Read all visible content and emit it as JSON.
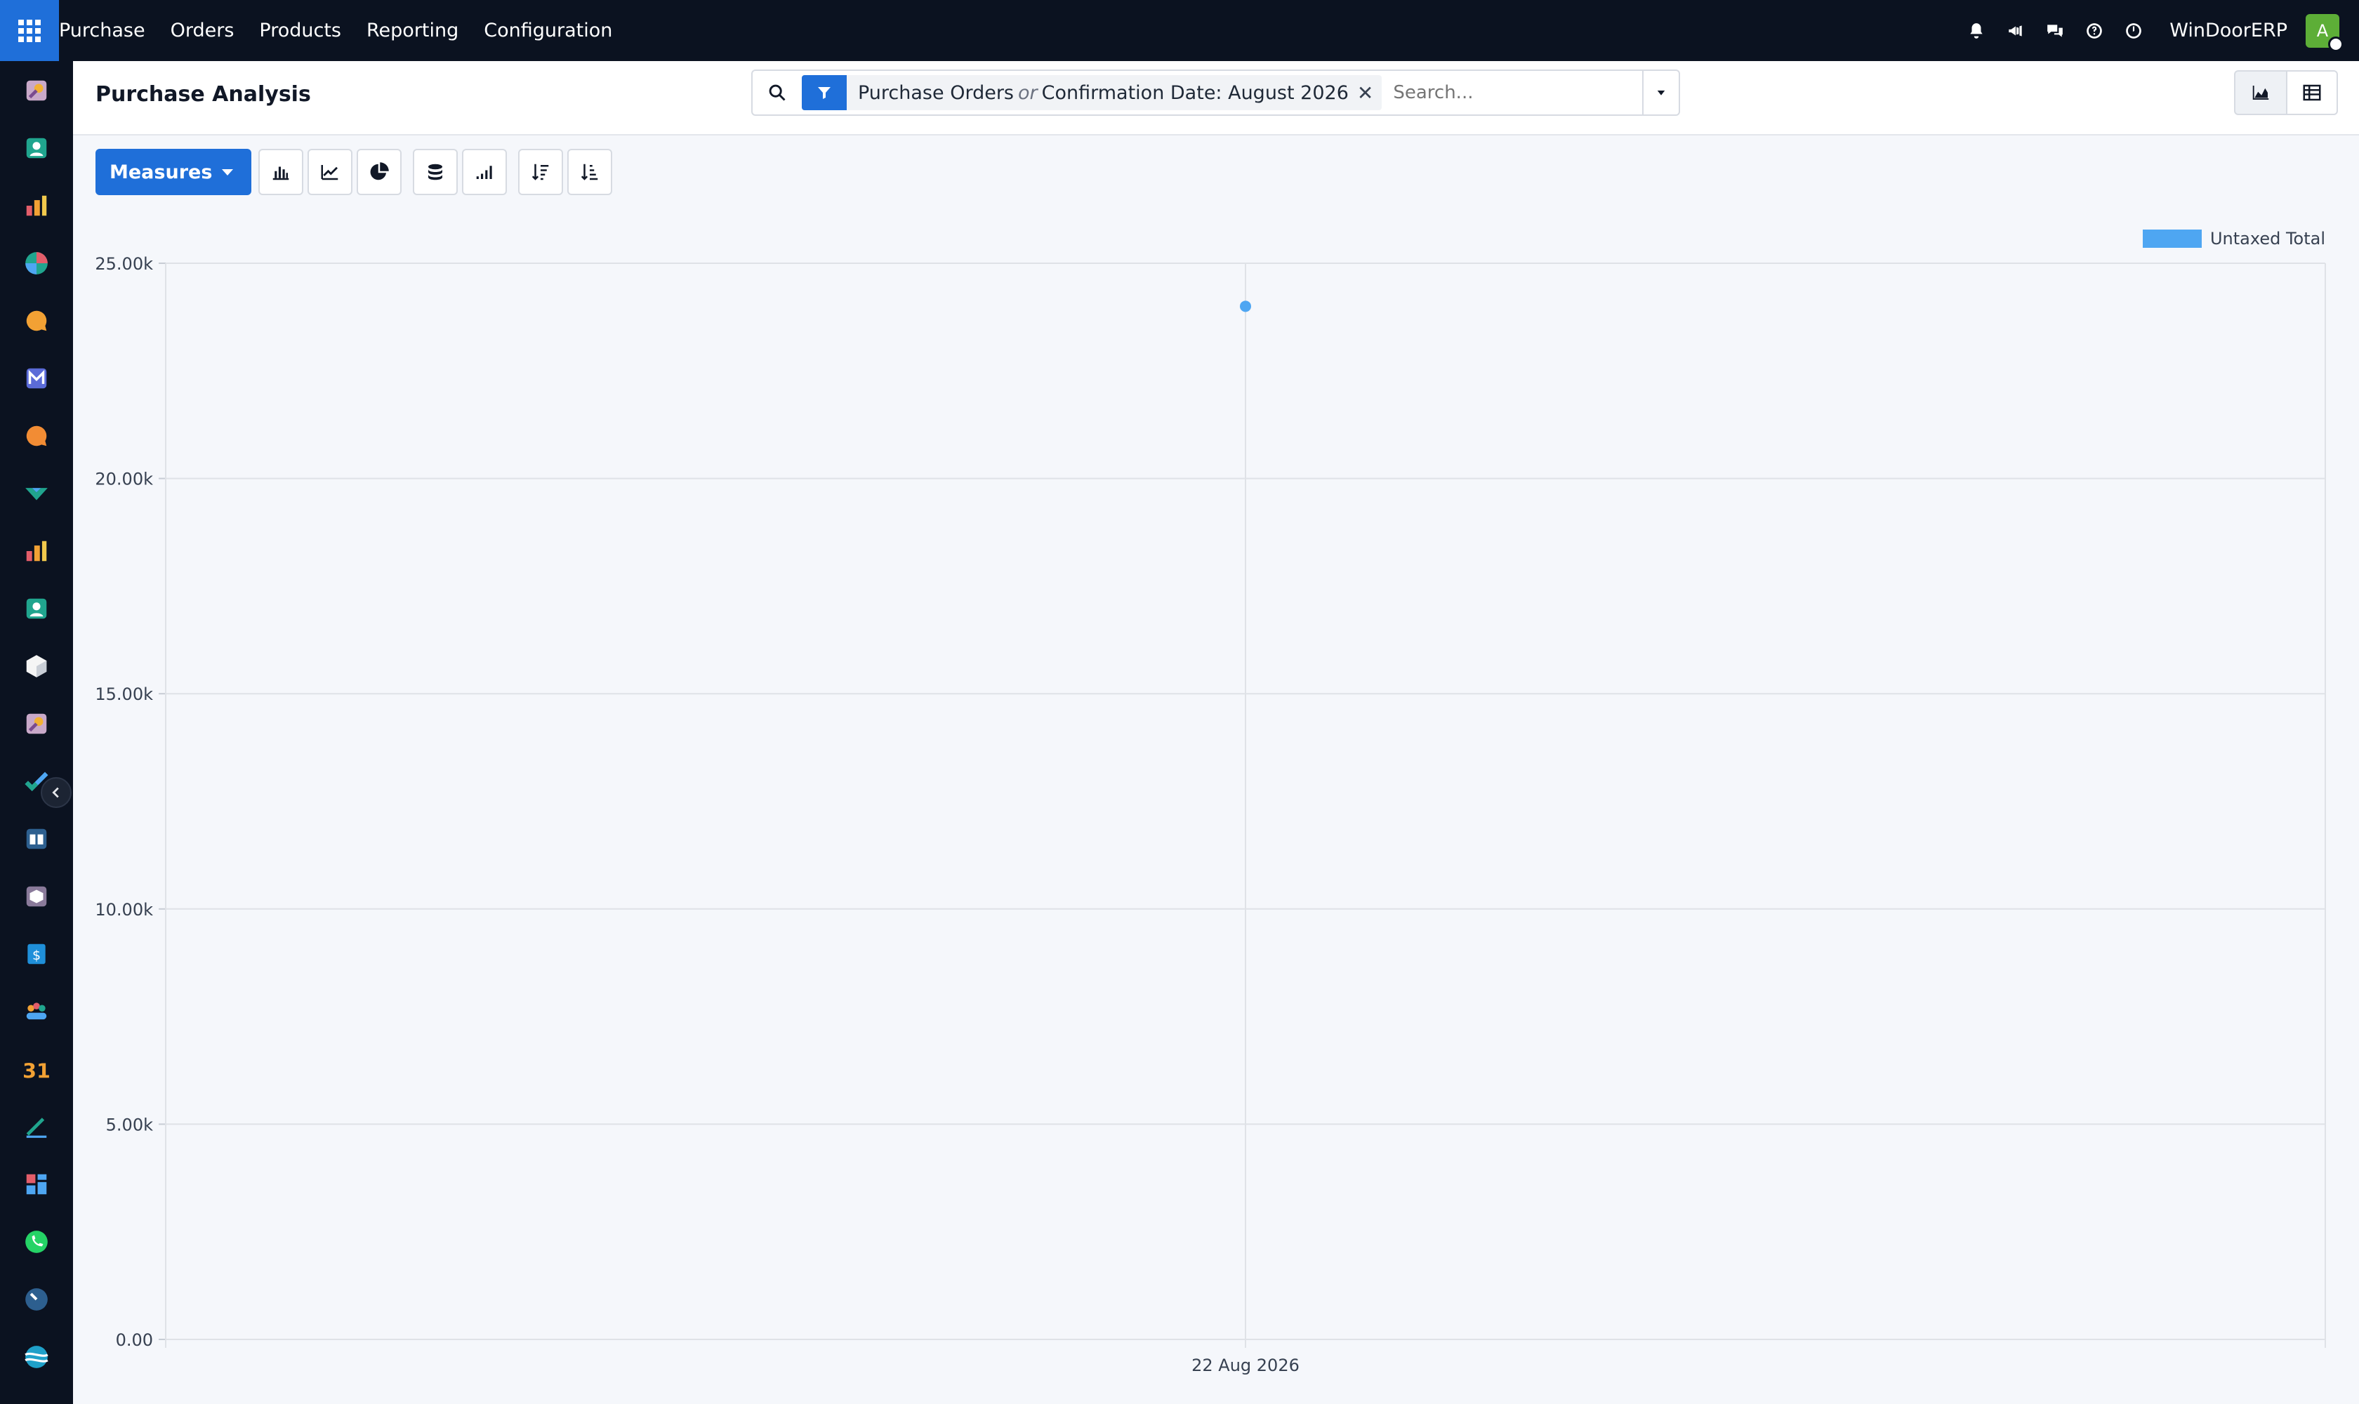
{
  "topbar": {
    "app_name": "Purchase",
    "menu": [
      "Orders",
      "Products",
      "Reporting",
      "Configuration"
    ],
    "company": "WinDoorERP",
    "avatar_initial": "A"
  },
  "control": {
    "title": "Purchase Analysis",
    "facet": {
      "part1": "Purchase Orders",
      "connector": "or",
      "part2": "Confirmation Date: August 2026",
      "remove": "✕"
    },
    "search_placeholder": "Search..."
  },
  "toolbar": {
    "measures_label": "Measures"
  },
  "sidebar_icons": [
    "discuss-icon",
    "contacts-icon",
    "dashboards-icon",
    "crm-icon",
    "chat-icon",
    "mail-icon",
    "livechat-icon",
    "sales-icon",
    "reporting-icon",
    "employees-icon",
    "inventory-icon",
    "discuss2-icon",
    "project-icon",
    "knowledge-icon",
    "shipping-icon",
    "invoicing-icon",
    "team-icon",
    "calendar-icon",
    "sign-icon",
    "apps-dashboard-icon",
    "whatsapp-icon",
    "timer-icon",
    "website-icon"
  ],
  "chart_data": {
    "type": "line",
    "x": [
      "22 Aug 2026"
    ],
    "series": [
      {
        "name": "Untaxed Total",
        "values": [
          24000
        ],
        "color": "#4ea6f2"
      }
    ],
    "y_ticks": [
      "0.00",
      "5.00k",
      "10.00k",
      "15.00k",
      "20.00k",
      "25.00k"
    ],
    "ylim": [
      0,
      25000
    ],
    "grid": true,
    "legend_position": "top-right"
  }
}
